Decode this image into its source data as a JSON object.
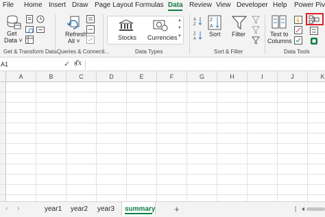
{
  "tabs": [
    "File",
    "Home",
    "Insert",
    "Draw",
    "Page Layout",
    "Formulas",
    "Data",
    "Review",
    "View",
    "Developer",
    "Help",
    "Power Pivot"
  ],
  "active_tab": "Data",
  "ribbon": {
    "get_data": {
      "line1": "Get",
      "line2": "Data ˅"
    },
    "refresh_all": {
      "line1": "Refresh",
      "line2": "All ˅"
    },
    "stocks": "Stocks",
    "currencies": "Currencies",
    "sort": "Sort",
    "filter": "Filter",
    "text_to_columns": {
      "line1": "Text to",
      "line2": "Columns"
    },
    "groups": {
      "get_transform": "Get & Transform Data",
      "queries": "Queries & Connecti...",
      "data_types": "Data Types",
      "sort_filter": "Sort & Filter",
      "data_tools": "Data Tools"
    }
  },
  "formula_bar": {
    "name_box": "A1",
    "fx": "fx",
    "cancel": "×",
    "confirm": "✓",
    "value": ""
  },
  "grid": {
    "columns": [
      "A",
      "B",
      "C",
      "D",
      "E",
      "F",
      "G",
      "H",
      "I",
      "J",
      "K"
    ]
  },
  "sheets": [
    "year1",
    "year2",
    "year3",
    "summary"
  ],
  "active_sheet": "summary",
  "colors": {
    "accent": "#107c41",
    "highlight": "#e01b24"
  }
}
